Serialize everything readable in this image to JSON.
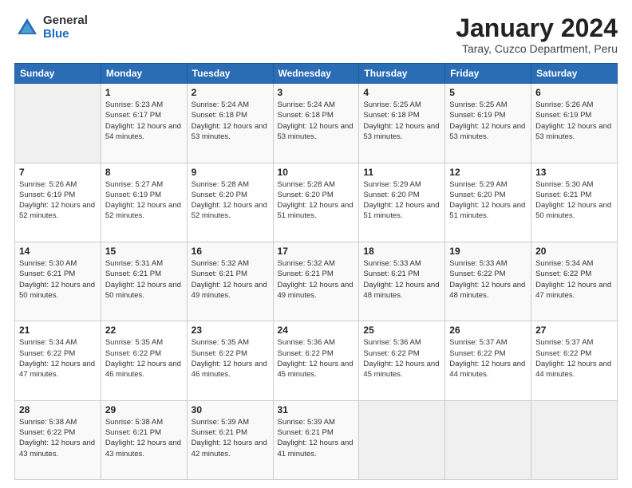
{
  "logo": {
    "general": "General",
    "blue": "Blue"
  },
  "header": {
    "month": "January 2024",
    "location": "Taray, Cuzco Department, Peru"
  },
  "days_of_week": [
    "Sunday",
    "Monday",
    "Tuesday",
    "Wednesday",
    "Thursday",
    "Friday",
    "Saturday"
  ],
  "weeks": [
    [
      {
        "num": "",
        "sunrise": "",
        "sunset": "",
        "daylight": "",
        "empty": true
      },
      {
        "num": "1",
        "sunrise": "5:23 AM",
        "sunset": "6:17 PM",
        "daylight": "12 hours and 54 minutes."
      },
      {
        "num": "2",
        "sunrise": "5:24 AM",
        "sunset": "6:18 PM",
        "daylight": "12 hours and 53 minutes."
      },
      {
        "num": "3",
        "sunrise": "5:24 AM",
        "sunset": "6:18 PM",
        "daylight": "12 hours and 53 minutes."
      },
      {
        "num": "4",
        "sunrise": "5:25 AM",
        "sunset": "6:18 PM",
        "daylight": "12 hours and 53 minutes."
      },
      {
        "num": "5",
        "sunrise": "5:25 AM",
        "sunset": "6:19 PM",
        "daylight": "12 hours and 53 minutes."
      },
      {
        "num": "6",
        "sunrise": "5:26 AM",
        "sunset": "6:19 PM",
        "daylight": "12 hours and 53 minutes."
      }
    ],
    [
      {
        "num": "7",
        "sunrise": "5:26 AM",
        "sunset": "6:19 PM",
        "daylight": "12 hours and 52 minutes."
      },
      {
        "num": "8",
        "sunrise": "5:27 AM",
        "sunset": "6:19 PM",
        "daylight": "12 hours and 52 minutes."
      },
      {
        "num": "9",
        "sunrise": "5:28 AM",
        "sunset": "6:20 PM",
        "daylight": "12 hours and 52 minutes."
      },
      {
        "num": "10",
        "sunrise": "5:28 AM",
        "sunset": "6:20 PM",
        "daylight": "12 hours and 51 minutes."
      },
      {
        "num": "11",
        "sunrise": "5:29 AM",
        "sunset": "6:20 PM",
        "daylight": "12 hours and 51 minutes."
      },
      {
        "num": "12",
        "sunrise": "5:29 AM",
        "sunset": "6:20 PM",
        "daylight": "12 hours and 51 minutes."
      },
      {
        "num": "13",
        "sunrise": "5:30 AM",
        "sunset": "6:21 PM",
        "daylight": "12 hours and 50 minutes."
      }
    ],
    [
      {
        "num": "14",
        "sunrise": "5:30 AM",
        "sunset": "6:21 PM",
        "daylight": "12 hours and 50 minutes."
      },
      {
        "num": "15",
        "sunrise": "5:31 AM",
        "sunset": "6:21 PM",
        "daylight": "12 hours and 50 minutes."
      },
      {
        "num": "16",
        "sunrise": "5:32 AM",
        "sunset": "6:21 PM",
        "daylight": "12 hours and 49 minutes."
      },
      {
        "num": "17",
        "sunrise": "5:32 AM",
        "sunset": "6:21 PM",
        "daylight": "12 hours and 49 minutes."
      },
      {
        "num": "18",
        "sunrise": "5:33 AM",
        "sunset": "6:21 PM",
        "daylight": "12 hours and 48 minutes."
      },
      {
        "num": "19",
        "sunrise": "5:33 AM",
        "sunset": "6:22 PM",
        "daylight": "12 hours and 48 minutes."
      },
      {
        "num": "20",
        "sunrise": "5:34 AM",
        "sunset": "6:22 PM",
        "daylight": "12 hours and 47 minutes."
      }
    ],
    [
      {
        "num": "21",
        "sunrise": "5:34 AM",
        "sunset": "6:22 PM",
        "daylight": "12 hours and 47 minutes."
      },
      {
        "num": "22",
        "sunrise": "5:35 AM",
        "sunset": "6:22 PM",
        "daylight": "12 hours and 46 minutes."
      },
      {
        "num": "23",
        "sunrise": "5:35 AM",
        "sunset": "6:22 PM",
        "daylight": "12 hours and 46 minutes."
      },
      {
        "num": "24",
        "sunrise": "5:36 AM",
        "sunset": "6:22 PM",
        "daylight": "12 hours and 45 minutes."
      },
      {
        "num": "25",
        "sunrise": "5:36 AM",
        "sunset": "6:22 PM",
        "daylight": "12 hours and 45 minutes."
      },
      {
        "num": "26",
        "sunrise": "5:37 AM",
        "sunset": "6:22 PM",
        "daylight": "12 hours and 44 minutes."
      },
      {
        "num": "27",
        "sunrise": "5:37 AM",
        "sunset": "6:22 PM",
        "daylight": "12 hours and 44 minutes."
      }
    ],
    [
      {
        "num": "28",
        "sunrise": "5:38 AM",
        "sunset": "6:22 PM",
        "daylight": "12 hours and 43 minutes."
      },
      {
        "num": "29",
        "sunrise": "5:38 AM",
        "sunset": "6:21 PM",
        "daylight": "12 hours and 43 minutes."
      },
      {
        "num": "30",
        "sunrise": "5:39 AM",
        "sunset": "6:21 PM",
        "daylight": "12 hours and 42 minutes."
      },
      {
        "num": "31",
        "sunrise": "5:39 AM",
        "sunset": "6:21 PM",
        "daylight": "12 hours and 41 minutes."
      },
      {
        "num": "",
        "sunrise": "",
        "sunset": "",
        "daylight": "",
        "empty": true
      },
      {
        "num": "",
        "sunrise": "",
        "sunset": "",
        "daylight": "",
        "empty": true
      },
      {
        "num": "",
        "sunrise": "",
        "sunset": "",
        "daylight": "",
        "empty": true
      }
    ]
  ]
}
